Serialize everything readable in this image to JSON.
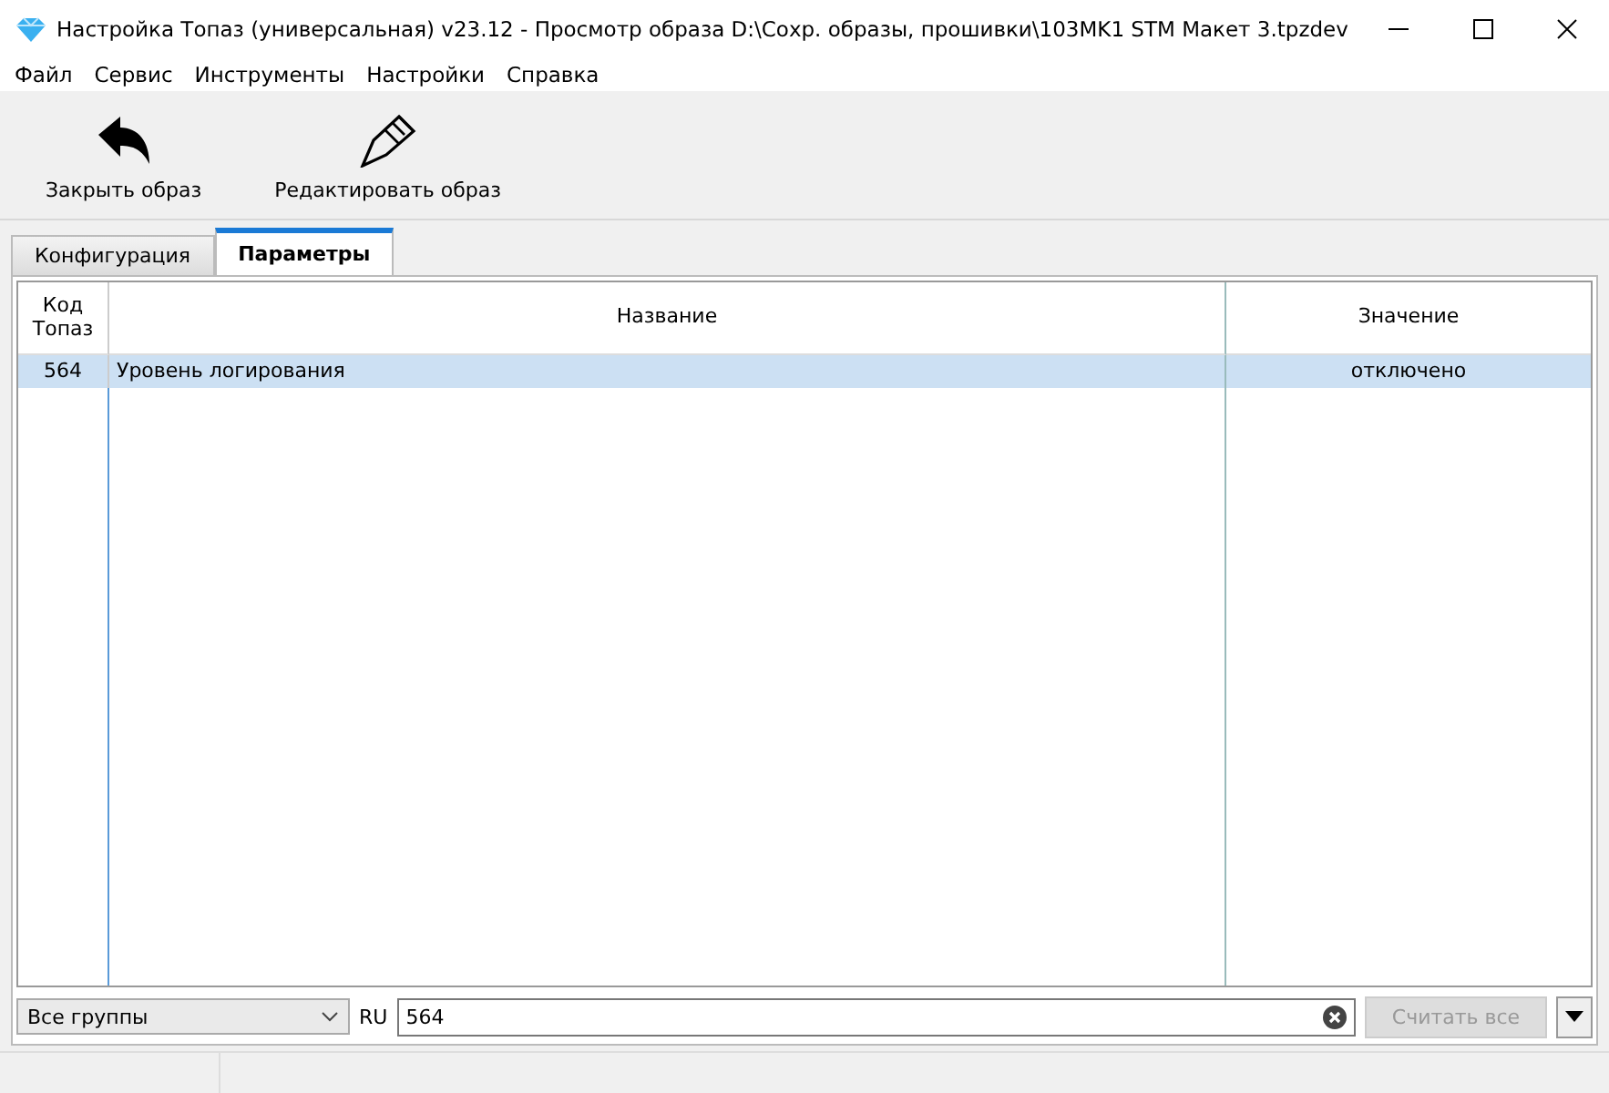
{
  "window": {
    "title": "Настройка Топаз (универсальная) v23.12 - Просмотр образа D:\\Сохр. образы, прошивки\\103MK1 STM Макет 3.tpzdev"
  },
  "menu": [
    "Файл",
    "Сервис",
    "Инструменты",
    "Настройки",
    "Справка"
  ],
  "toolbar": [
    {
      "kind": "back",
      "label": "Закрыть образ"
    },
    {
      "kind": "edit",
      "label": "Редактировать образ"
    }
  ],
  "tabs": [
    {
      "label": "Конфигурация",
      "selected": false
    },
    {
      "label": "Параметры",
      "selected": true
    }
  ],
  "table": {
    "columns": [
      "Код\nТопаз",
      "Название",
      "Значение"
    ],
    "rows": [
      {
        "cells": [
          "564",
          "Уровень логирования",
          "отключено"
        ],
        "selected": true
      }
    ]
  },
  "filter": {
    "group": "Все группы",
    "language": "RU",
    "search": "564",
    "read_button": {
      "label": "Считать все",
      "disabled": true
    }
  }
}
